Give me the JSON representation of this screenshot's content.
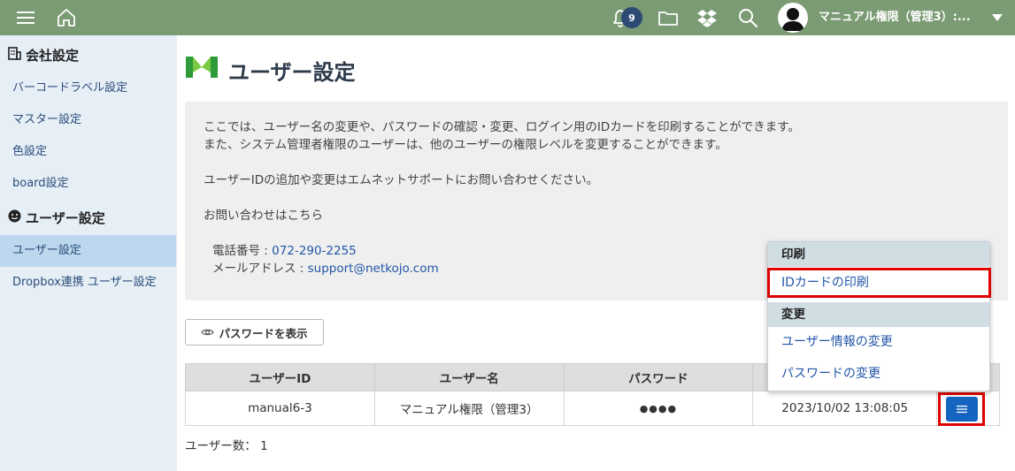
{
  "header": {
    "notification_count": "9",
    "user_name": "マニュアル権限（管理3）:..."
  },
  "sidebar": {
    "sections": [
      {
        "title": "会社設定",
        "items": [
          {
            "label": "バーコードラベル設定"
          },
          {
            "label": "マスター設定"
          },
          {
            "label": "色設定"
          },
          {
            "label": "board設定"
          }
        ]
      },
      {
        "title": "ユーザー設定",
        "items": [
          {
            "label": "ユーザー設定",
            "active": true
          },
          {
            "label": "Dropbox連携 ユーザー設定"
          }
        ]
      }
    ]
  },
  "main": {
    "title": "ユーザー設定",
    "info": {
      "line1": "ここでは、ユーザー名の変更や、パスワードの確認・変更、ログイン用のIDカードを印刷することができます。",
      "line2": "また、システム管理者権限のユーザーは、他のユーザーの権限レベルを変更することができます。",
      "line3": "ユーザーIDの追加や変更はエムネットサポートにお問い合わせください。",
      "line4": "お問い合わせはこちら",
      "phone_label": "電話番号 : ",
      "phone": "072-290-2255",
      "email_label": "メールアドレス : ",
      "email": "support@netkojo.com"
    },
    "show_password_button": "パスワードを表示",
    "table": {
      "headers": [
        "ユーザーID",
        "ユーザー名",
        "パスワード",
        "",
        ""
      ],
      "rows": [
        {
          "user_id": "manual6-3",
          "user_name": "マニュアル権限（管理3）",
          "password": "●●●●",
          "updated": "2023/10/02 13:08:05"
        }
      ]
    },
    "user_count": "ユーザー数： 1"
  },
  "dropdown": {
    "print_header": "印刷",
    "print_id_card": "IDカードの印刷",
    "change_header": "変更",
    "change_user_info": "ユーザー情報の変更",
    "change_password": "パスワードの変更"
  },
  "colors": {
    "topbar": "#7a9b73",
    "sidebar": "#e6eef6",
    "accent": "#1565c0",
    "highlight": "#e00000"
  }
}
